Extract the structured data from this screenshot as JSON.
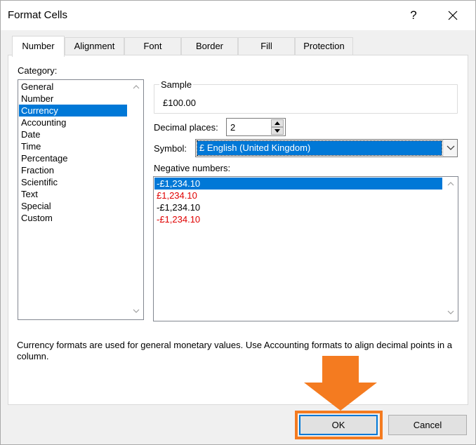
{
  "window": {
    "title": "Format Cells",
    "help_label": "?"
  },
  "tabs": [
    {
      "label": "Number",
      "active": true
    },
    {
      "label": "Alignment",
      "active": false
    },
    {
      "label": "Font",
      "active": false
    },
    {
      "label": "Border",
      "active": false
    },
    {
      "label": "Fill",
      "active": false
    },
    {
      "label": "Protection",
      "active": false
    }
  ],
  "category": {
    "label": "Category:",
    "items": [
      "General",
      "Number",
      "Currency",
      "Accounting",
      "Date",
      "Time",
      "Percentage",
      "Fraction",
      "Scientific",
      "Text",
      "Special",
      "Custom"
    ],
    "selected": "Currency"
  },
  "sample": {
    "label": "Sample",
    "value": "£100.00"
  },
  "decimal_places": {
    "label": "Decimal places:",
    "value": "2"
  },
  "symbol": {
    "label": "Symbol:",
    "value": "£ English (United Kingdom)"
  },
  "negative_numbers": {
    "label": "Negative numbers:",
    "items": [
      {
        "text": "-£1,234.10",
        "red": false,
        "selected": true
      },
      {
        "text": "£1,234.10",
        "red": true,
        "selected": false
      },
      {
        "text": "-£1,234.10",
        "red": false,
        "selected": false
      },
      {
        "text": "-£1,234.10",
        "red": true,
        "selected": false
      }
    ]
  },
  "description": "Currency formats are used for general monetary values.  Use Accounting formats to align decimal points in a column.",
  "buttons": {
    "ok": "OK",
    "cancel": "Cancel"
  },
  "colors": {
    "selection": "#0078d7",
    "negative_red": "#e00000",
    "annotation": "#f47b20"
  }
}
